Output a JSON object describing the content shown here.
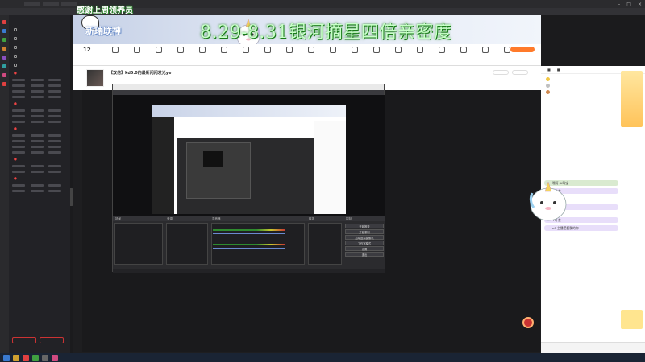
{
  "overlay": {
    "thanks": "感谢上周领养员",
    "event": "8.29-8.31银河摘星四倍亲密度",
    "brand": "新瑞联神"
  },
  "site": {
    "date_day": "12"
  },
  "room": {
    "title": "【双倍】kd5.0的最新闪闪发光ye"
  },
  "obs": {
    "panels": {
      "scenes": "场景",
      "sources": "来源",
      "mixer": "混音器",
      "transitions": "转场",
      "controls": "控制"
    },
    "controls": [
      "开始推流",
      "开始录制",
      "启动虚拟摄像机",
      "工作室模式",
      "设置",
      "退出"
    ]
  },
  "chat": {
    "messages": [
      {
        "text": "嘿呀 Ai叫宝",
        "type": "g"
      },
      {
        "text": "+叶茶",
        "type": "p"
      },
      {
        "text": "+牛肯",
        "type": "p"
      },
      {
        "text": "+叶茶",
        "type": "p"
      },
      {
        "text": "e0 主播把握我的你",
        "type": "p"
      }
    ]
  },
  "colors": {
    "accent": "#ff5d23",
    "event_glow": "#1a7a1a",
    "sidebar_bg": "#222226",
    "chat_green": "#d9ead0",
    "chat_purple": "#e8defa"
  }
}
